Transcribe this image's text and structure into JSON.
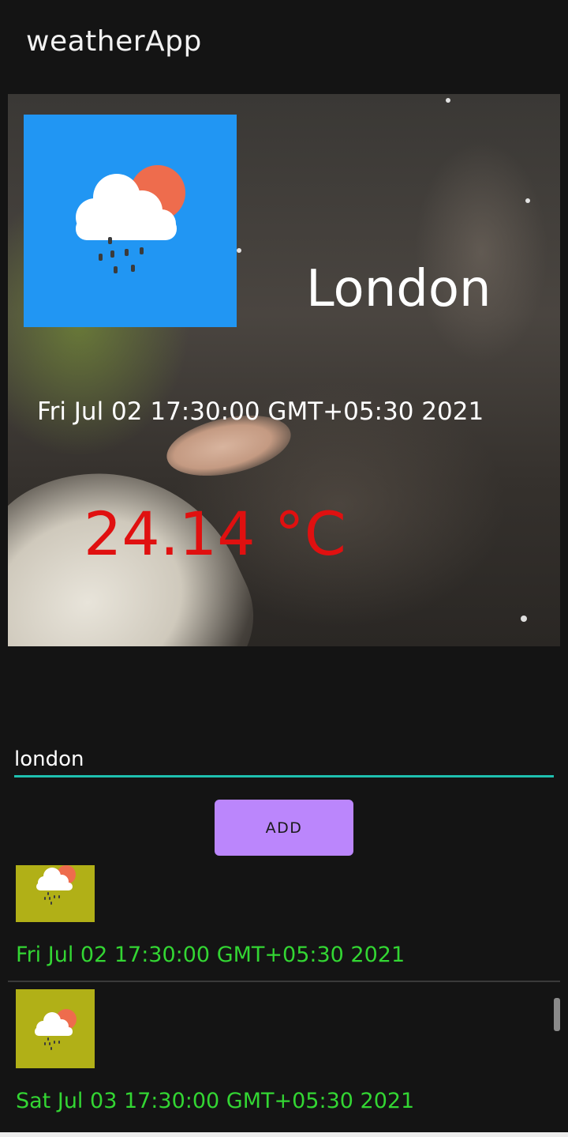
{
  "app": {
    "title": "weatherApp"
  },
  "current": {
    "city": "London",
    "datetime": "Fri Jul 02 17:30:00 GMT+05:30 2021",
    "temperature": "24.14 °C",
    "icon": "rain-cloud-sun-icon",
    "icon_bg": "#2196f3",
    "temp_color": "#e01010"
  },
  "search": {
    "value": "london"
  },
  "add_button": {
    "label": "ADD"
  },
  "forecast": [
    {
      "date": "Fri Jul 02 17:30:00 GMT+05:30 2021",
      "icon": "rain-cloud-sun-icon"
    },
    {
      "date": "Sat Jul 03 17:30:00 GMT+05:30 2021",
      "icon": "rain-cloud-sun-icon"
    }
  ],
  "colors": {
    "accent": "#1ec0b0",
    "button": "#bb86fc",
    "list_text": "#33d633",
    "thumb_bg": "#b1b017"
  }
}
